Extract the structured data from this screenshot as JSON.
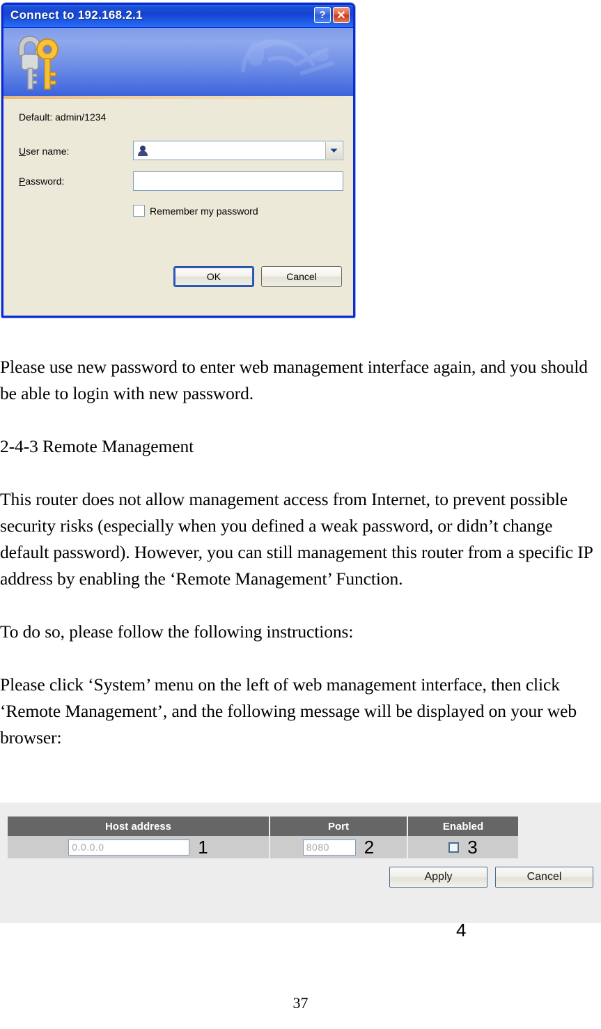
{
  "dialog": {
    "title": "Connect to 192.168.2.1",
    "help_button": "?",
    "close_button": "✕",
    "keys_icon": "keys-icon",
    "default_hint": "Default: admin/1234",
    "username_label_underlined": "U",
    "username_label_rest": "ser name:",
    "password_label_underlined": "P",
    "password_label_rest": "assword:",
    "username_value": "",
    "password_value": "",
    "remember_underlined": "R",
    "remember_rest": "emember my password",
    "remember_checked": false,
    "ok_label": "OK",
    "cancel_label": "Cancel"
  },
  "doc": {
    "paragraphs": [
      "Please use new password to enter web management interface again, and you should be able to login with new password.",
      "2-4-3 Remote Management",
      "This router does not allow management access from Internet, to prevent possible security risks (especially when you defined a weak password, or didn’t change default password). However, you can still management this router from a specific IP address by enabling the ‘Remote Management’ Function.",
      "To do so, please follow the following instructions:",
      "Please click ‘System’ menu on the left of web management interface, then click ‘Remote Management’, and the following message will be displayed on your web browser:"
    ]
  },
  "web_ui": {
    "columns": [
      "Host address",
      "Port",
      "Enabled"
    ],
    "row": {
      "host_address_value": "0.0.0.0",
      "port_value": "8080",
      "enabled_checked": false
    },
    "annotations": {
      "host": "1",
      "port": "2",
      "enabled": "3",
      "buttons": "4"
    },
    "apply_label": "Apply",
    "cancel_label": "Cancel"
  },
  "page": {
    "number": "37"
  }
}
